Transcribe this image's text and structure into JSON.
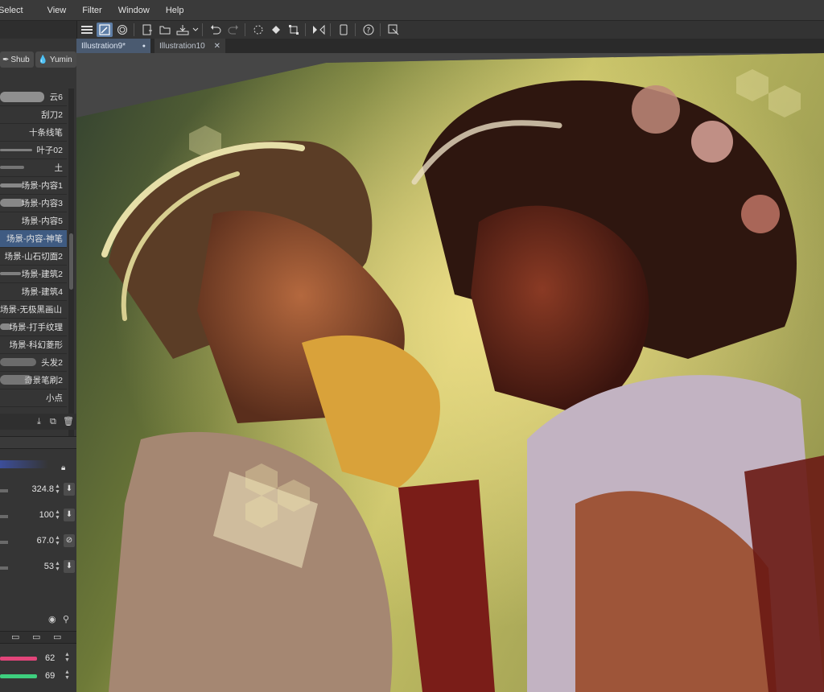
{
  "menu": [
    "Select",
    "View",
    "Filter",
    "Window",
    "Help"
  ],
  "toolbar_icons": [
    "menu-icon",
    "hand-draw-icon",
    "spiral-icon",
    "new-file-icon",
    "open-folder-icon",
    "save-icon",
    "undo-icon",
    "redo-icon",
    "loading-icon",
    "fill-icon",
    "transform-icon",
    "flip-icon",
    "device-icon",
    "help-icon",
    "settings-icon"
  ],
  "tabs": {
    "active": {
      "label": "Illustration9*",
      "marker": "●"
    },
    "inactive": {
      "label": "Illustration10",
      "close": "✕"
    }
  },
  "subtool_tabs": [
    "Shub",
    "Yumin"
  ],
  "brushes": [
    {
      "label": "云6",
      "selected": false
    },
    {
      "label": "刮刀2",
      "selected": false
    },
    {
      "label": "十条线笔",
      "selected": false
    },
    {
      "label": "叶子02",
      "selected": false
    },
    {
      "label": "土",
      "selected": false
    },
    {
      "label": "场景-内容1",
      "selected": false
    },
    {
      "label": "场景-内容3",
      "selected": false
    },
    {
      "label": "场景-内容5",
      "selected": false
    },
    {
      "label": "场景-内容-神笔",
      "selected": true
    },
    {
      "label": "场景-山石切面2",
      "selected": false
    },
    {
      "label": "场景-建筑2",
      "selected": false
    },
    {
      "label": "场景-建筑4",
      "selected": false
    },
    {
      "label": "场景-无极黑画山",
      "selected": false
    },
    {
      "label": "场景-打手纹理",
      "selected": false
    },
    {
      "label": "场景-科幻菱形",
      "selected": false
    },
    {
      "label": "头发2",
      "selected": false
    },
    {
      "label": "奇景笔刷2",
      "selected": false
    },
    {
      "label": "小点",
      "selected": false
    }
  ],
  "properties": [
    {
      "value": "324.8"
    },
    {
      "value": "100"
    },
    {
      "value": "67.0"
    },
    {
      "value": "53"
    }
  ],
  "color_sliders": [
    {
      "value": "62",
      "color": "#e2457a"
    },
    {
      "value": "69",
      "color": "#3ecf7e"
    }
  ]
}
